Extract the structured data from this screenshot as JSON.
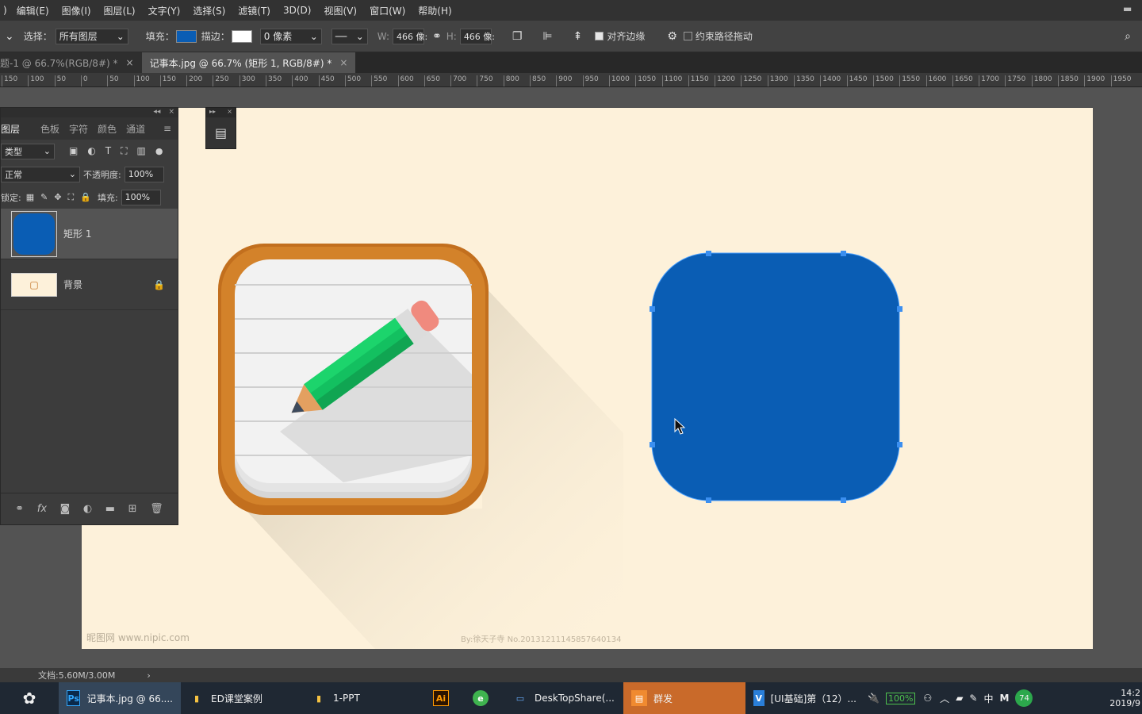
{
  "menu": [
    "编辑(E)",
    "图像(I)",
    "图层(L)",
    "文字(Y)",
    "选择(S)",
    "滤镜(T)",
    "3D(D)",
    "视图(V)",
    "窗口(W)",
    "帮助(H)"
  ],
  "options": {
    "select_label": "选择：",
    "select_value": "所有图层",
    "fill_label": "填充：",
    "fill_color": "#0a5db4",
    "stroke_label": "描边：",
    "stroke_width": "0 像素",
    "w_label": "W:",
    "w_value": "466 像:",
    "h_label": "H:",
    "h_value": "466 像:",
    "align_edges": "对齐边缘",
    "constrain_path": "约束路径拖动"
  },
  "tabs": [
    {
      "label": "题-1 @ 66.7%(RGB/8#) *",
      "active": false
    },
    {
      "label": "记事本.jpg @ 66.7% (矩形 1, RGB/8#) *",
      "active": true
    }
  ],
  "ruler": [
    "150",
    "100",
    "50",
    "0",
    "50",
    "100",
    "150",
    "200",
    "250",
    "300",
    "350",
    "400",
    "450",
    "500",
    "550",
    "600",
    "650",
    "700",
    "750",
    "800",
    "850",
    "900",
    "950",
    "1000",
    "1050",
    "1100",
    "1150",
    "1200",
    "1250",
    "1300",
    "1350",
    "1400",
    "1450",
    "1500",
    "1550",
    "1600",
    "1650",
    "1700",
    "1750",
    "1800",
    "1850",
    "1900",
    "1950"
  ],
  "layers_panel": {
    "tabs": [
      "图层",
      "色板",
      "字符",
      "颜色",
      "通道"
    ],
    "kind": "类型",
    "blend": "正常",
    "opacity_label": "不透明度:",
    "opacity": "100%",
    "lock_label": "锁定:",
    "fill_label": "填充:",
    "fill": "100%",
    "layers": [
      {
        "name": "矩形 1",
        "selected": true
      },
      {
        "name": "背景",
        "selected": false
      }
    ]
  },
  "canvas": {
    "bg": "#fdf1da",
    "shape_color": "#0a5db4",
    "wm1": "昵图网 www.nipic.com",
    "wm2": "By:徐天子寺 No.20131211145857640134"
  },
  "status": {
    "doc": "文档:5.60M/3.00M"
  },
  "taskbar": {
    "items": [
      {
        "icon": "Ps",
        "label": "记事本.jpg @ 66...."
      },
      {
        "icon": "",
        "label": "ED课堂案例"
      },
      {
        "icon": "",
        "label": "1-PPT"
      },
      {
        "icon": "Ai",
        "label": ""
      },
      {
        "icon": "",
        "label": ""
      },
      {
        "icon": "",
        "label": "DeskTopShare(..."
      },
      {
        "icon": "",
        "label": "群发"
      },
      {
        "icon": "",
        "label": "[UI基础]第（12）..."
      }
    ],
    "battery": "100%",
    "ime": "中",
    "badge": "74",
    "time": "14:2",
    "date": "2019/9"
  }
}
